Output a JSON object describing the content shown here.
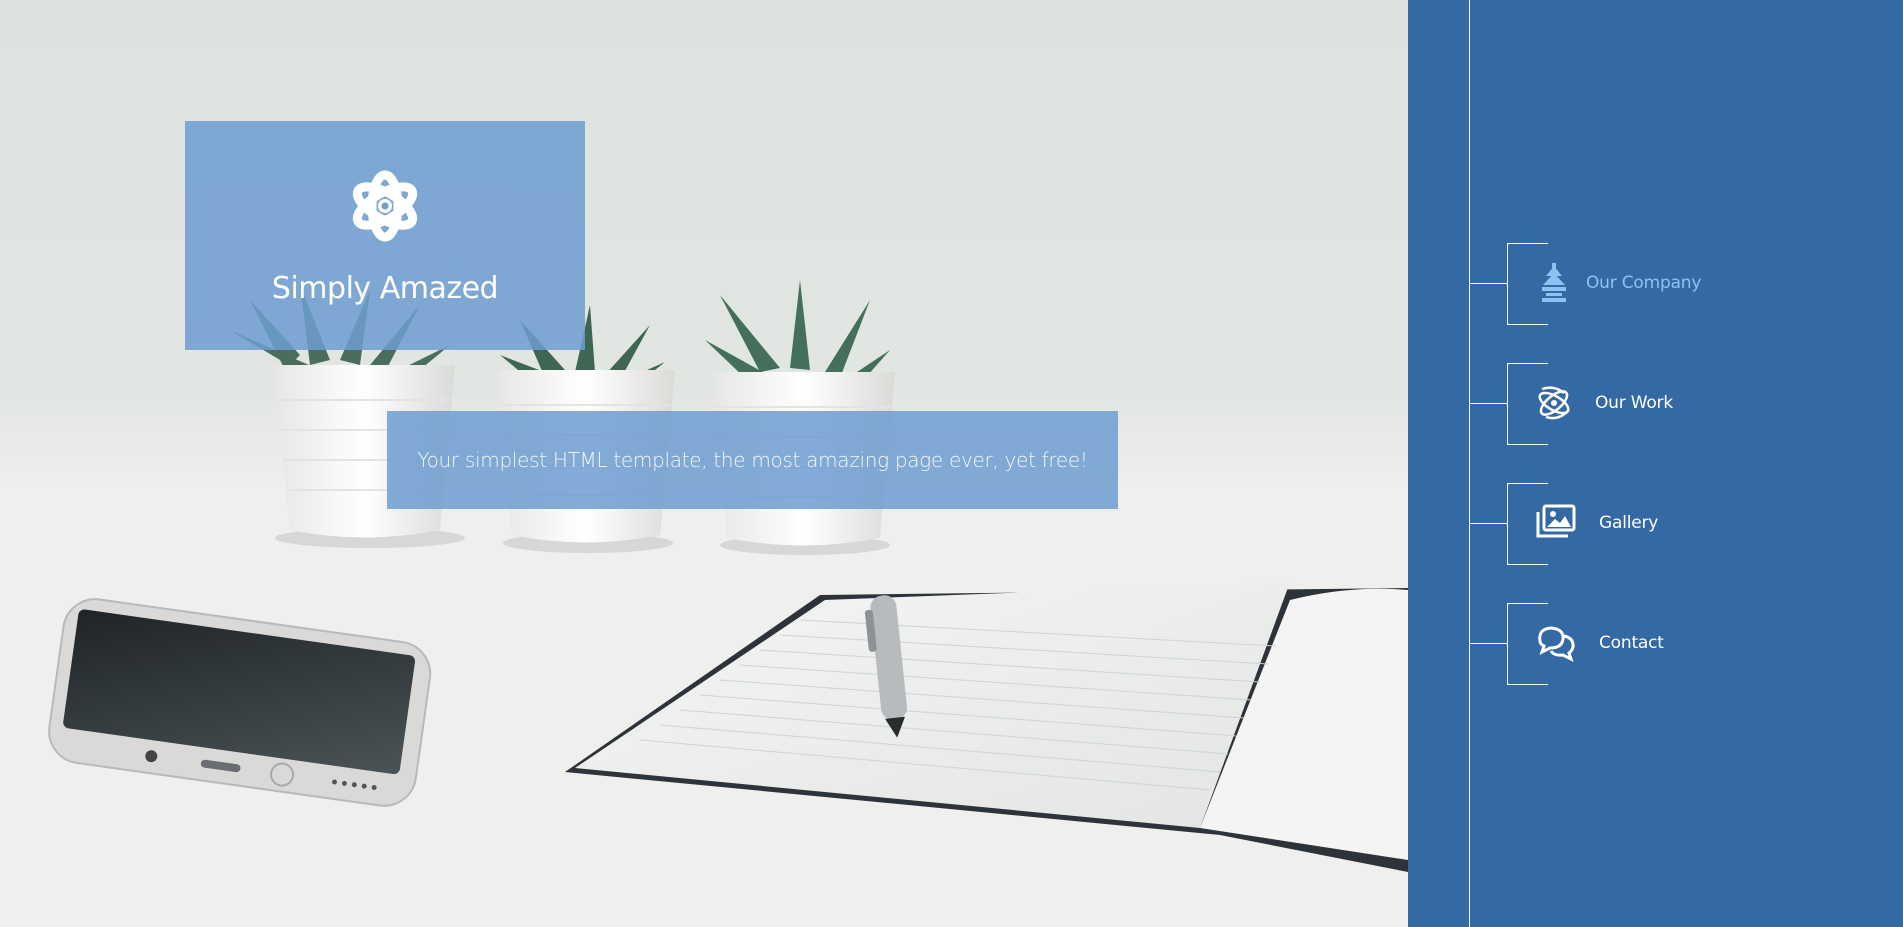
{
  "brand": {
    "title": "Simply Amazed",
    "icon": "atom-icon"
  },
  "hero": {
    "tagline": "Your simplest HTML template, the most amazing page ever, yet free!",
    "box_color": "#6c9ed0"
  },
  "sidebar": {
    "background": "#3469a3",
    "active_color": "#8cc2f4",
    "items": [
      {
        "label": "Our Company",
        "icon": "tree-icon",
        "active": true
      },
      {
        "label": "Our Work",
        "icon": "atom-swirl-icon",
        "active": false
      },
      {
        "label": "Gallery",
        "icon": "gallery-icon",
        "active": false
      },
      {
        "label": "Contact",
        "icon": "chat-bubbles-icon",
        "active": false
      }
    ]
  }
}
